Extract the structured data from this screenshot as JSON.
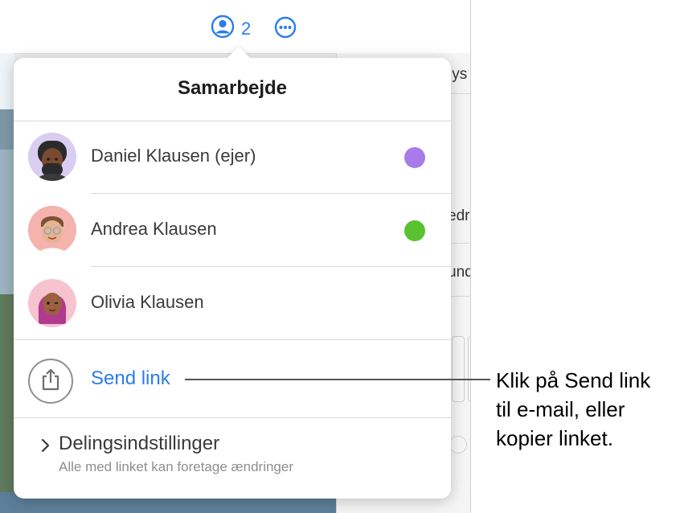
{
  "toolbar": {
    "collaborator_count": "2",
    "collab_icon": "person-circle-icon",
    "more_icon": "ellipsis-circle-icon",
    "accent": "#2b7de9"
  },
  "background": {
    "frag1": ".ys",
    "frag2": "edr",
    "frag3": "und"
  },
  "popover": {
    "title": "Samarbejde",
    "participants": [
      {
        "name": "Daniel Klausen (ejer)",
        "avatar": "memoji-avatar",
        "status_color": "#a97bea"
      },
      {
        "name": "Andrea Klausen",
        "avatar": "memoji-avatar",
        "status_color": "#5ac130"
      },
      {
        "name": "Olivia Klausen",
        "avatar": "memoji-avatar",
        "status_color": ""
      }
    ],
    "send_link_label": "Send link",
    "send_link_icon": "share-icon",
    "sharing": {
      "title": "Delingsindstillinger",
      "subtitle": "Alle med linket kan foretage ændringer",
      "icon": "chevron-right-icon"
    }
  },
  "callout": {
    "line1": "Klik på Send link",
    "line2": "til e-mail, eller",
    "line3": "kopier linket."
  }
}
